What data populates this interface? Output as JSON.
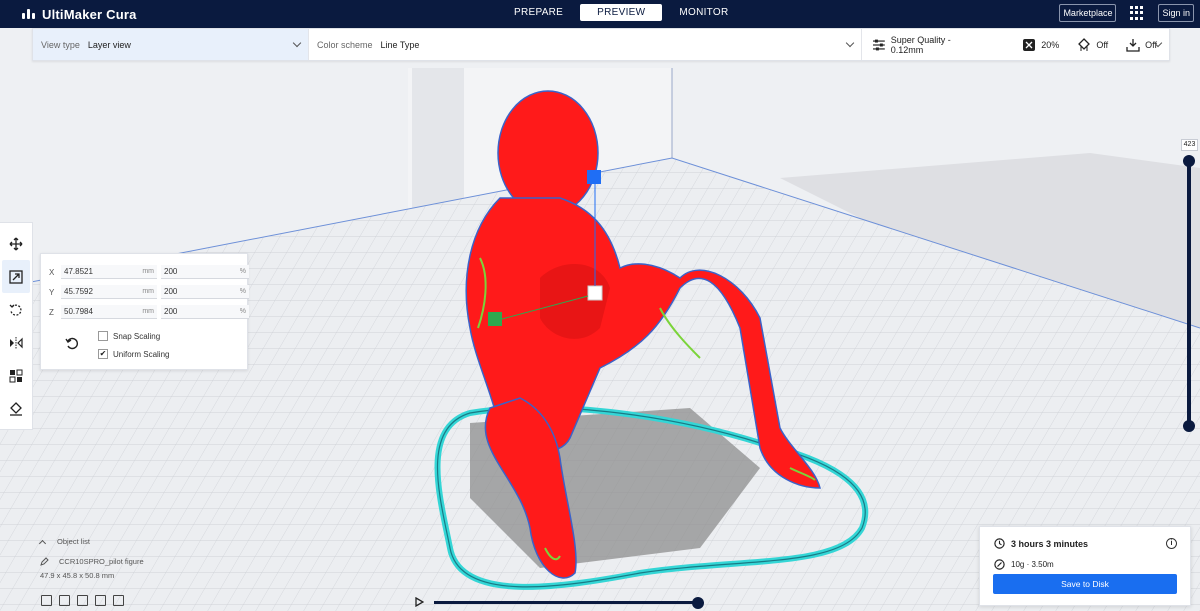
{
  "app": {
    "title": "UltiMaker Cura"
  },
  "stages": [
    {
      "label": "PREPARE"
    },
    {
      "label": "PREVIEW"
    },
    {
      "label": "MONITOR"
    }
  ],
  "header_right": {
    "marketplace": "Marketplace",
    "sign_in": "Sign in"
  },
  "topbar": {
    "view_type_label": "View type",
    "view_type_value": "Layer view",
    "color_scheme_label": "Color scheme",
    "color_scheme_value": "Line Type",
    "quality": "Super Quality - 0.12mm",
    "infill": "20%",
    "support": "Off",
    "adhesion": "Off"
  },
  "scale_panel": {
    "x_label": "X",
    "x_mm": "47.8521",
    "x_pct": "200",
    "y_label": "Y",
    "y_mm": "45.7592",
    "y_pct": "200",
    "z_label": "Z",
    "z_mm": "50.7984",
    "z_pct": "200",
    "unit_mm": "mm",
    "unit_pct": "%",
    "snap_scaling": "Snap Scaling",
    "snap_checked": false,
    "uniform_scaling": "Uniform Scaling",
    "uniform_checked": true,
    "check_mark": "✔"
  },
  "layer_slider": {
    "current_layer": "423",
    "value": 1.0
  },
  "playback": {
    "progress": 1.0
  },
  "object_list": {
    "header": "Object list",
    "object_name": "CCR10SPRO_pilot figure",
    "dimensions": "47.9 x 45.8 x 50.8 mm"
  },
  "print_info": {
    "time": "3 hours 3 minutes",
    "material": "10g · 3.50m",
    "info_glyph": "i",
    "save_button": "Save to Disk"
  },
  "colors": {
    "header_bg": "#0a1a3f",
    "model": "#ff1a1a",
    "skirt": "#34d6d6",
    "accent": "#196ef0",
    "handle_blue": "#1f6ef5",
    "handle_green": "#2fa84f"
  }
}
